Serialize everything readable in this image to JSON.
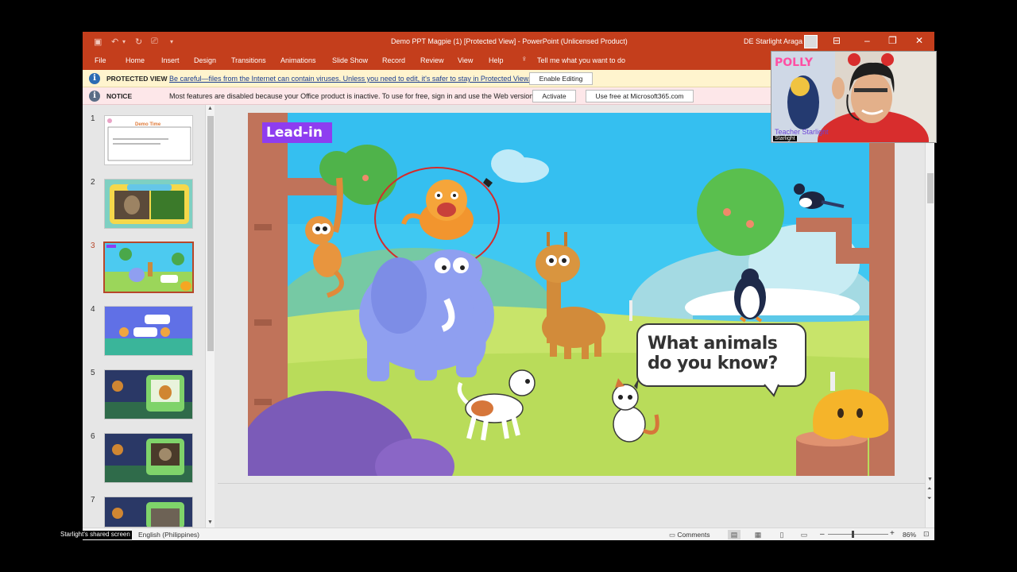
{
  "window": {
    "title": "Demo PPT Magpie (1) [Protected View]  -  PowerPoint (Unlicensed Product)",
    "user": "DE Starlight Araga"
  },
  "ribbon": {
    "tabs": [
      "File",
      "Home",
      "Insert",
      "Design",
      "Transitions",
      "Animations",
      "Slide Show",
      "Record",
      "Review",
      "View",
      "Help"
    ],
    "tell_me": "Tell me what you want to do"
  },
  "protected_view": {
    "label": "PROTECTED VIEW",
    "message": "Be careful—files from the Internet can contain viruses. Unless you need to edit, it's safer to stay in Protected View.",
    "button": "Enable Editing"
  },
  "notice": {
    "label": "NOTICE",
    "message": "Most features are disabled because your Office product is inactive. To use for free, sign in and use the Web version.",
    "activate_button": "Activate",
    "web_button": "Use free at Microsoft365.com"
  },
  "thumbnails": {
    "numbers": [
      "1",
      "2",
      "3",
      "4",
      "5",
      "6",
      "7"
    ],
    "selected": 3,
    "slide1_title": "Demo Time"
  },
  "slide": {
    "tag": "Lead-in",
    "bubble": "What animals do you know?"
  },
  "status": {
    "language": "English (Philippines)",
    "comments": "Comments",
    "zoom": "86%"
  },
  "overlay": {
    "shared_screen": "Starlight's shared screen",
    "cam_name": "Starlight",
    "cam_overlay": "Teacher Starlight",
    "cam_logo": "POLLY"
  },
  "colors": {
    "accent": "#c43e1c",
    "slide_tag": "#8e3df0",
    "sky": "#3ec8f2"
  },
  "icons": {
    "save": "save-icon",
    "undo": "undo-icon",
    "redo": "redo-icon",
    "present": "present-from-start-icon",
    "tell_me": "lightbulb-icon",
    "info": "info-icon"
  }
}
